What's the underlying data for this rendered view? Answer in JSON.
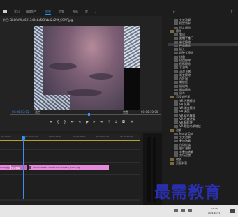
{
  "menu": {
    "tabs": [
      {
        "label": "学习"
      },
      {
        "label": "编辑"
      },
      {
        "label": "颜色"
      },
      {
        "label": "效果",
        "active": true
      },
      {
        "label": "音频"
      },
      {
        "label": "图形"
      },
      {
        "label": "库"
      }
    ]
  },
  "monitor": {
    "title": "节目: 3b0fbf2be6917d0ebc5f3fcbd2e29f_CONF.jpg",
    "overlay_text": "© 抖音号：",
    "timecode_left": "00:00:03:01",
    "fit": "适合",
    "quality": "完整",
    "timecode_right": "00:00:10:00"
  },
  "timeline": {
    "ruler_ticks": [
      "00:00:00",
      "00:00:02:00",
      "00:00:04:00",
      "00:00:06:00",
      "00:00:08:00",
      "00:00:10:00"
    ],
    "clip_a": "CONF.jpg",
    "fx_label": "交叉溶解",
    "clip_label": "3b0fbf2be6917d0ebc5f3fcbd2e29f_CONF.jpg"
  },
  "effects_tree": [
    {
      "type": "fx",
      "label": "交叉溶解"
    },
    {
      "type": "fx",
      "label": "恒定功率"
    },
    {
      "type": "fx",
      "label": "恒定增益"
    },
    {
      "type": "folder",
      "label": "擦除"
    },
    {
      "type": "fx",
      "label": "划出"
    },
    {
      "type": "fx",
      "label": "双侧平推门",
      "selected": true
    },
    {
      "type": "fx",
      "label": "带状擦除"
    },
    {
      "type": "fx",
      "label": "径向擦除"
    },
    {
      "type": "fx",
      "label": "插入"
    },
    {
      "type": "fx",
      "label": "时钟式擦除"
    },
    {
      "type": "fx",
      "label": "棋盘"
    },
    {
      "type": "fx",
      "label": "棋盘擦除"
    },
    {
      "type": "fx",
      "label": "楔形擦除"
    },
    {
      "type": "fx",
      "label": "水波块"
    },
    {
      "type": "fx",
      "label": "油漆飞溅"
    },
    {
      "type": "fx",
      "label": "渐变擦除"
    },
    {
      "type": "fx",
      "label": "百叶窗"
    },
    {
      "type": "fx",
      "label": "螺旋框"
    },
    {
      "type": "fx",
      "label": "随机块"
    },
    {
      "type": "fx",
      "label": "随机擦除"
    },
    {
      "type": "fx",
      "label": "风车"
    },
    {
      "type": "folder",
      "label": "沉浸式视频"
    },
    {
      "type": "fx",
      "label": "VR 光圈擦除"
    },
    {
      "type": "fx",
      "label": "VR 光线"
    },
    {
      "type": "fx",
      "label": "VR 渐变擦除"
    },
    {
      "type": "fx",
      "label": "VR 漏光"
    },
    {
      "type": "fx",
      "label": "VR 球形模糊"
    },
    {
      "type": "fx",
      "label": "VR 色度泄漏"
    },
    {
      "type": "fx",
      "label": "VR 随机块"
    },
    {
      "type": "fx",
      "label": "VR 默比乌斯缩放"
    },
    {
      "type": "folder",
      "label": "溶解"
    },
    {
      "type": "fx",
      "label": "MorphCut"
    },
    {
      "type": "fx",
      "label": "交叉溶解"
    },
    {
      "type": "fx",
      "label": "叠加溶解"
    },
    {
      "type": "fx",
      "label": "白场过渡"
    },
    {
      "type": "fx",
      "label": "胶片溶解"
    },
    {
      "type": "fx",
      "label": "非叠加溶解"
    },
    {
      "type": "fx",
      "label": "黑场过渡"
    },
    {
      "type": "folder",
      "label": "缩放"
    },
    {
      "type": "folder",
      "label": "页面剥落"
    }
  ],
  "taskbar": {
    "time": "10:23",
    "date": "2021/10/11"
  },
  "watermark": "最需教育"
}
